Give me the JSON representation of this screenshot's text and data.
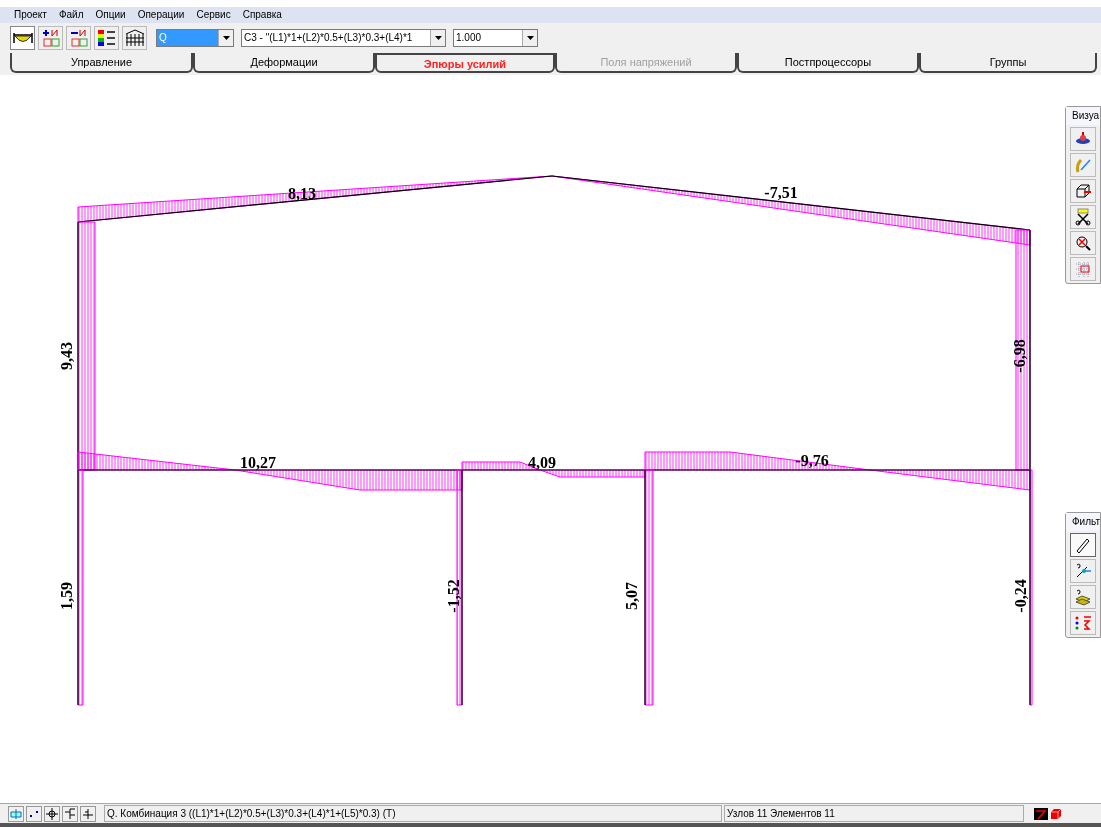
{
  "menu": [
    "Проект",
    "Файл",
    "Опции",
    "Операции",
    "Сервис",
    "Справка"
  ],
  "toolbar": {
    "combos": [
      {
        "value": "Q",
        "focused": true
      },
      {
        "value": "C3 - \"(L1)*1+(L2)*0.5+(L3)*0.3+(L4)*1",
        "focused": false
      },
      {
        "value": "1.000",
        "focused": false
      }
    ]
  },
  "tabs": [
    {
      "label": "Управление",
      "selected": false,
      "disabled": false
    },
    {
      "label": "Деформации",
      "selected": false,
      "disabled": false
    },
    {
      "label": "Эпюры усилий",
      "selected": true,
      "disabled": false
    },
    {
      "label": "Поля напряжений",
      "selected": false,
      "disabled": true
    },
    {
      "label": "Постпроцессоры",
      "selected": false,
      "disabled": false
    },
    {
      "label": "Группы",
      "selected": false,
      "disabled": false
    }
  ],
  "diagram": {
    "values": [
      "8,13",
      "-7,51",
      "9,43",
      "-6,98",
      "10,27",
      "4,09",
      "-9,76",
      "1,59",
      "-1,52",
      "5,07",
      "-0,24"
    ]
  },
  "panels": [
    {
      "title": "Визуа"
    },
    {
      "title": "Фильт"
    }
  ],
  "status_bar": {
    "message": "Q. Комбинация 3 ((L1)*1+(L2)*0.5+(L3)*0.3+(L4)*1+(L5)*0.3) (T)",
    "counts": "Узлов 11 Элементов 11"
  }
}
